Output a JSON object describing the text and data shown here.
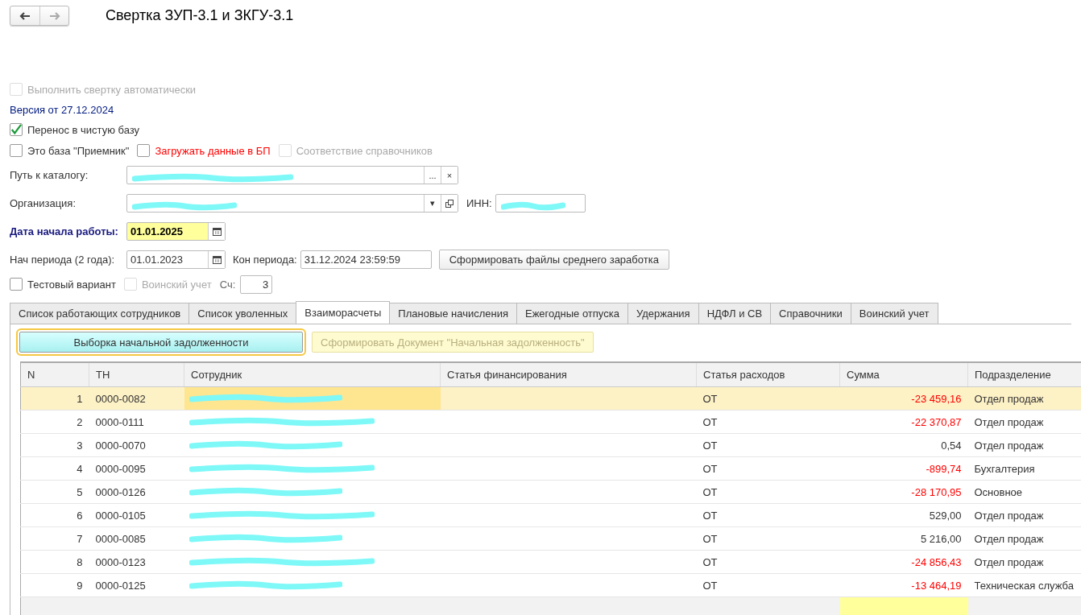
{
  "window": {
    "title": "Свертка ЗУП-3.1 и ЗКГУ-3.1"
  },
  "auto_fold": {
    "label": "Выполнить свертку автоматически",
    "checked": false,
    "disabled": true
  },
  "version": "Версия от 27.12.2024",
  "clean_base": {
    "label": "Перенос в чистую базу",
    "checked": true
  },
  "options": [
    {
      "label": "Это база \"Приемник\"",
      "checked": false,
      "disabled": false,
      "warning": false
    },
    {
      "label": "Загружать данные в БП",
      "checked": false,
      "disabled": false,
      "warning": true
    },
    {
      "label": "Соответствие справочников",
      "checked": false,
      "disabled": true,
      "warning": false
    }
  ],
  "path": {
    "label": "Путь к каталогу:",
    "redacted": true,
    "browse": "...",
    "clear": "×"
  },
  "organization": {
    "label": "Организация:",
    "redacted": true,
    "dropdown": "▾",
    "inn_label": "ИНН:",
    "inn_redacted": true
  },
  "start_date": {
    "label": "Дата начала работы:",
    "value": "01.01.2025"
  },
  "period": {
    "start_label": "Нач периода (2 года):",
    "start": "01.01.2023",
    "end_label": "Кон периода:",
    "end": "31.12.2024 23:59:59",
    "button": "Сформировать файлы среднего заработка"
  },
  "test_options": [
    {
      "label": "Тестовый вариант",
      "checked": false,
      "disabled": false
    },
    {
      "label": "Воинский учет",
      "checked": false,
      "disabled": true
    }
  ],
  "counter": {
    "label": "Сч:",
    "value": "3"
  },
  "tabs": [
    {
      "label": "Список работающих сотрудников",
      "selected": false
    },
    {
      "label": "Список уволенных",
      "selected": false
    },
    {
      "label": "Взаиморасчеты",
      "selected": true
    },
    {
      "label": "Плановые начисления",
      "selected": false
    },
    {
      "label": "Ежегодные отпуска",
      "selected": false
    },
    {
      "label": "Удержания",
      "selected": false
    },
    {
      "label": "НДФЛ и СВ",
      "selected": false
    },
    {
      "label": "Справочники",
      "selected": false
    },
    {
      "label": "Воинский учет",
      "selected": false
    }
  ],
  "actions": [
    {
      "label": "Выборка начальной задолженности",
      "disabled": false
    },
    {
      "label": "Сформировать Документ \"Начальная задолженность\"",
      "disabled": true
    }
  ],
  "table": {
    "columns": [
      "N",
      "ТН",
      "Сотрудник",
      "Статья финансирования",
      "Статья расходов",
      "Сумма",
      "Подразделение"
    ],
    "rows": [
      {
        "n": "1",
        "tn": "0000-0082",
        "expense": "ОТ",
        "amount": "-23 459,16",
        "negative": true,
        "department": "Отдел продаж",
        "selected": true
      },
      {
        "n": "2",
        "tn": "0000-0111",
        "expense": "ОТ",
        "amount": "-22 370,87",
        "negative": true,
        "department": "Отдел продаж",
        "selected": false
      },
      {
        "n": "3",
        "tn": "0000-0070",
        "expense": "ОТ",
        "amount": "0,54",
        "negative": false,
        "department": "Отдел продаж",
        "selected": false
      },
      {
        "n": "4",
        "tn": "0000-0095",
        "expense": "ОТ",
        "amount": "-899,74",
        "negative": true,
        "department": "Бухгалтерия",
        "selected": false
      },
      {
        "n": "5",
        "tn": "0000-0126",
        "expense": "ОТ",
        "amount": "-28 170,95",
        "negative": true,
        "department": "Основное",
        "selected": false
      },
      {
        "n": "6",
        "tn": "0000-0105",
        "expense": "ОТ",
        "amount": "529,00",
        "negative": false,
        "department": "Отдел продаж",
        "selected": false
      },
      {
        "n": "7",
        "tn": "0000-0085",
        "expense": "ОТ",
        "amount": "5 216,00",
        "negative": false,
        "department": "Отдел продаж",
        "selected": false
      },
      {
        "n": "8",
        "tn": "0000-0123",
        "expense": "ОТ",
        "amount": "-24 856,43",
        "negative": true,
        "department": "Отдел продаж",
        "selected": false
      },
      {
        "n": "9",
        "tn": "0000-0125",
        "expense": "ОТ",
        "amount": "-13 464,19",
        "negative": true,
        "department": "Техническая служба",
        "selected": false
      }
    ]
  }
}
